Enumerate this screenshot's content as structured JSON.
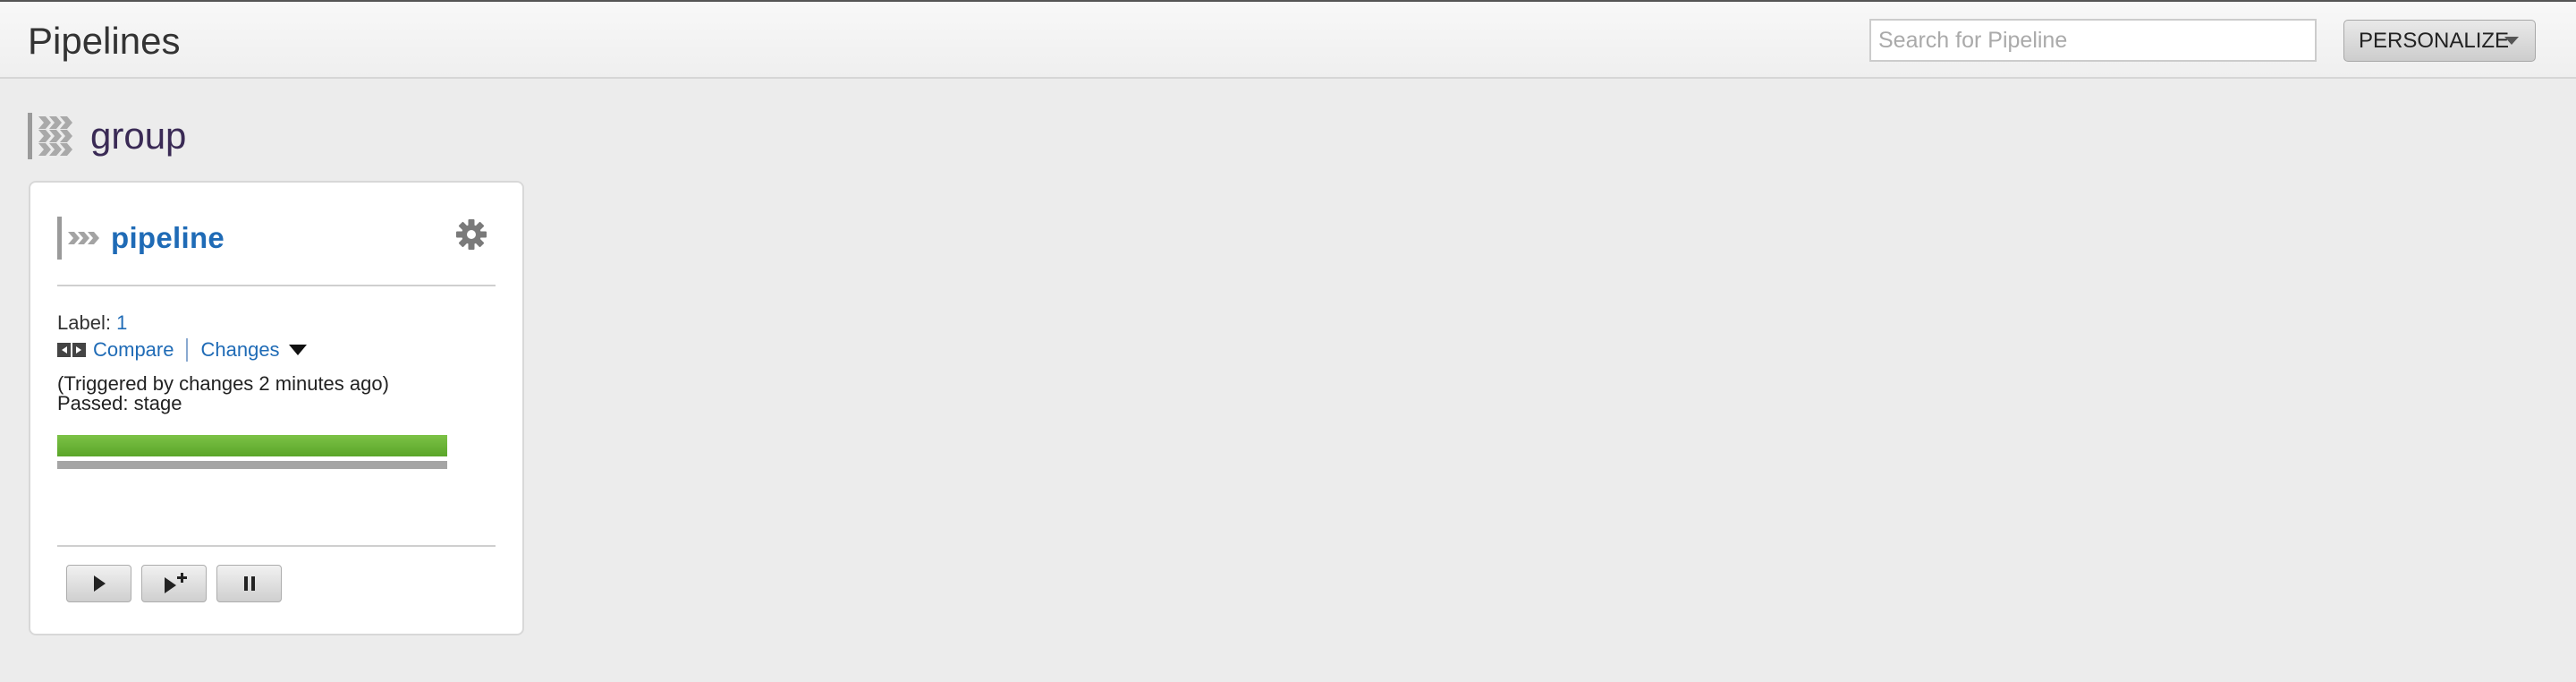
{
  "header": {
    "title": "Pipelines",
    "search_placeholder": "Search for Pipeline",
    "personalize_label": "PERSONALIZE"
  },
  "group": {
    "name": "group",
    "icon": "pipeline-group-icon"
  },
  "pipeline": {
    "name": "pipeline",
    "icon": "pipeline-icon",
    "settings_icon": "gear-icon",
    "label_caption": "Label:",
    "label_value": "1",
    "compare_label": "Compare",
    "changes_label": "Changes",
    "trigger_text": "(Triggered by changes 2 minutes ago)",
    "passed_text": "Passed: stage",
    "stage_status": "passed",
    "stage_color": "#6db63a",
    "controls": [
      {
        "name": "trigger",
        "icon": "play-icon"
      },
      {
        "name": "trigger-with-options",
        "icon": "play-plus-icon"
      },
      {
        "name": "pause",
        "icon": "pause-icon"
      }
    ]
  },
  "colors": {
    "link": "#1f6bb6",
    "background": "#ececec",
    "group_title": "#3a2a55"
  }
}
